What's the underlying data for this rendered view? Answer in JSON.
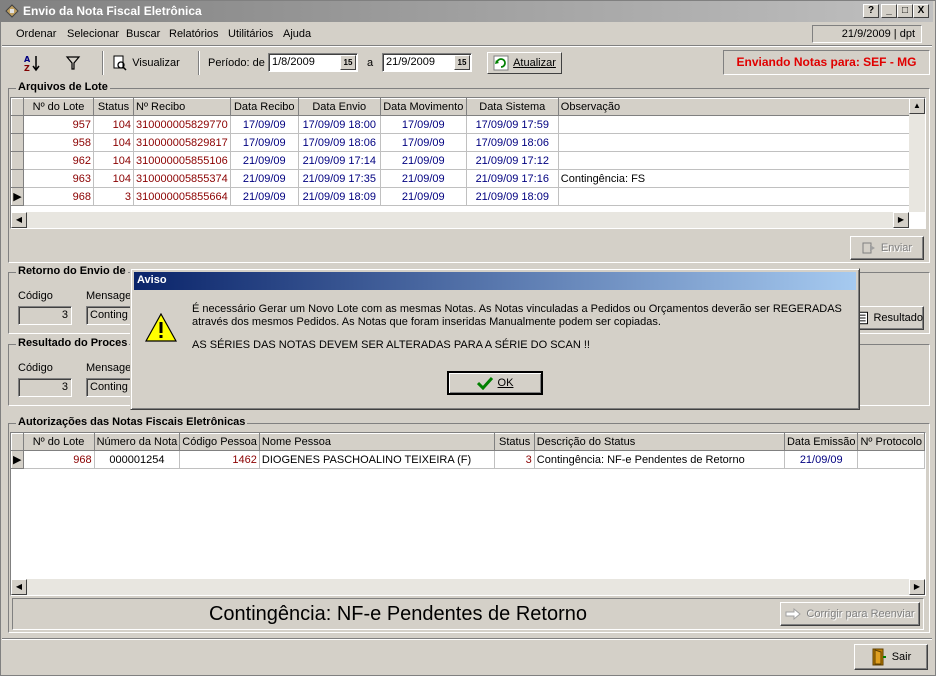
{
  "window": {
    "title": "Envio da Nota Fiscal Eletrônica",
    "buttons": [
      "?",
      "_",
      "□",
      "X"
    ]
  },
  "menu": {
    "items": [
      "Ordenar",
      "Selecionar",
      "Buscar",
      "Relatórios",
      "Utilitários",
      "Ajuda"
    ],
    "status": "21/9/2009 | dpt"
  },
  "toolbar": {
    "sort_icon": "sort-az-icon",
    "filter_icon": "filter-icon",
    "visualizar_label": "Visualizar",
    "periodo_label": "Período: de",
    "date_from": "1/8/2009",
    "a_label": "a",
    "date_to": "21/9/2009",
    "atualizar_label": "Atualizar",
    "enviando": "Enviando Notas para: SEF - MG"
  },
  "lotes": {
    "title": "Arquivos de Lote",
    "columns": [
      "Nº do Lote",
      "Status",
      "Nº Recibo",
      "Data Recibo",
      "Data Envio",
      "Data Movimento",
      "Data Sistema",
      "Observação"
    ],
    "rows": [
      [
        "957",
        "104",
        "310000005829770",
        "17/09/09",
        "17/09/09 18:00",
        "17/09/09",
        "17/09/09 17:59",
        ""
      ],
      [
        "958",
        "104",
        "310000005829817",
        "17/09/09",
        "17/09/09 18:06",
        "17/09/09",
        "17/09/09 18:06",
        ""
      ],
      [
        "962",
        "104",
        "310000005855106",
        "21/09/09",
        "21/09/09 17:14",
        "21/09/09",
        "21/09/09 17:12",
        ""
      ],
      [
        "963",
        "104",
        "310000005855374",
        "21/09/09",
        "21/09/09 17:35",
        "21/09/09",
        "21/09/09 17:16",
        "Contingência: FS"
      ],
      [
        "968",
        "3",
        "310000005855664",
        "21/09/09",
        "21/09/09 18:09",
        "21/09/09",
        "21/09/09 18:09",
        ""
      ]
    ],
    "enviar_label": "Enviar"
  },
  "retorno": {
    "title": "Retorno do Envio de",
    "codigo_label": "Código",
    "codigo": "3",
    "mensagem_label": "Mensage",
    "mensagem": "Conting",
    "resultado_label": "Resultado"
  },
  "resultado": {
    "title": "Resultado do Proces",
    "codigo_label": "Código",
    "codigo": "3",
    "mensagem_label": "Mensage",
    "mensagem": "Conting"
  },
  "autorizacoes": {
    "title": "Autorizações das Notas Fiscais Eletrônicas",
    "columns": [
      "Nº do Lote",
      "Número da Nota",
      "Código Pessoa",
      "Nome Pessoa",
      "Status",
      "Descrição do Status",
      "Data Emissão",
      "Nº Protocolo"
    ],
    "rows": [
      [
        "968",
        "000001254",
        "1462",
        "DIOGENES PASCHOALINO TEIXEIRA (F)",
        "3",
        "Contingência: NF-e Pendentes de Retorno",
        "21/09/09",
        ""
      ]
    ],
    "status_big": "Contingência: NF-e Pendentes de Retorno",
    "corrigir_label": "Corrigir para Reenviar"
  },
  "sair_label": "Sair",
  "dialog": {
    "title": "Aviso",
    "line1": "É necessário Gerar um Novo Lote com as mesmas Notas. As Notas vinculadas a Pedidos ou Orçamentos deverão ser REGERADAS",
    "line2": "através dos mesmos Pedidos. As Notas que foram inseridas Manualmente podem ser copiadas.",
    "line3": "AS SÉRIES DAS NOTAS DEVEM SER ALTERADAS PARA A SÉRIE DO SCAN !!",
    "ok_label": "OK"
  }
}
